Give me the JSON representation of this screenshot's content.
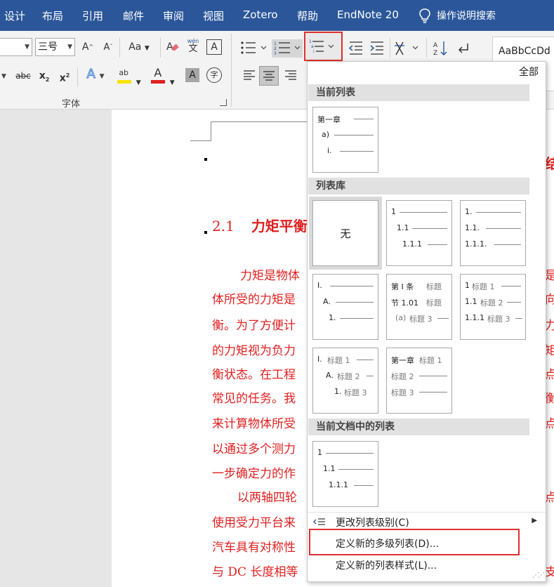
{
  "menubar": {
    "items": [
      "设计",
      "布局",
      "引用",
      "邮件",
      "审阅",
      "视图",
      "Zotero",
      "帮助",
      "EndNote 20"
    ],
    "tell_me": "操作说明搜索"
  },
  "ribbon": {
    "font_size": "三号",
    "grow_font": "A",
    "shrink_font": "A",
    "change_case": "Aa",
    "phonetic_top": "wén",
    "phonetic_bottom": "文",
    "char_border": "A",
    "strikethrough": "abc",
    "subscript": "x",
    "subscript_mark": "2",
    "superscript": "x",
    "superscript_mark": "2",
    "text_effects": "A",
    "highlight": "ab",
    "font_color": "A",
    "char_shading": "A",
    "enclose": "字",
    "font_group_label": "字体",
    "styles_preview": "AaBbCcDd",
    "colors": {
      "highlight": "#f5e400",
      "font_color": "#e02020",
      "text_effects": "#3a78d6"
    }
  },
  "document": {
    "heading_num": "2.1",
    "heading_text": "力矩平衡",
    "lines": [
      "力矩是物体",
      "体所受的力矩是",
      "衡。为了方便计",
      "的力矩视为负力",
      "衡状态。在工程",
      "常见的任务。我",
      "来计算物体所受",
      "以通过多个测力",
      "一步确定力的作",
      "以两轴四轮",
      "使用受力平台来",
      "汽车具有对称性",
      "与 DC 长度相等"
    ],
    "right_fragments": [
      "是",
      "向",
      "力",
      "矩",
      "点",
      "衡",
      "点",
      "",
      "",
      "点",
      "",
      "",
      "支"
    ],
    "top_right_fragment": "结"
  },
  "dropdown": {
    "filter": "全部",
    "sections": {
      "current_list": "当前列表",
      "list_library": "列表库",
      "document_lists": "当前文档中的列表"
    },
    "current_list_tile": {
      "l1": "第一章",
      "l2": "a)",
      "l3": "i."
    },
    "library": {
      "none": "无",
      "tile2": {
        "l1": "1",
        "l2": "1.1",
        "l3": "1.1.1"
      },
      "tile3": {
        "l1": "1.",
        "l2": "1.1.",
        "l3": "1.1.1."
      },
      "tile4": {
        "l1": "I.",
        "l2": "A.",
        "l3": "1."
      },
      "tile5": {
        "l1a": "第 Ⅰ 条",
        "l1b": "标题",
        "l2a": "节 1.01",
        "l2b": "标题",
        "l3a": "(a)",
        "l3b": "标题 3"
      },
      "tile6": {
        "l1a": "1",
        "l1b": "标题 1",
        "l2a": "1.1",
        "l2b": "标题 2",
        "l3a": "1.1.1",
        "l3b": "标题 3"
      },
      "tile7": {
        "l1a": "I.",
        "l1b": "标题 1",
        "l2a": "A.",
        "l2b": "标题 2",
        "l3a": "1.",
        "l3b": "标题 3"
      },
      "tile8": {
        "l1a": "第一章",
        "l1b": "标题 1",
        "l2b": "标题 2",
        "l3b": "标题 3"
      }
    },
    "document_tile": {
      "l1": "1",
      "l2": "1.1",
      "l3": "1.1.1"
    },
    "menu": {
      "change_level": "更改列表级别(C)",
      "define_new_multilevel": "定义新的多级列表(D)...",
      "define_new_style": "定义新的列表样式(L)..."
    }
  }
}
